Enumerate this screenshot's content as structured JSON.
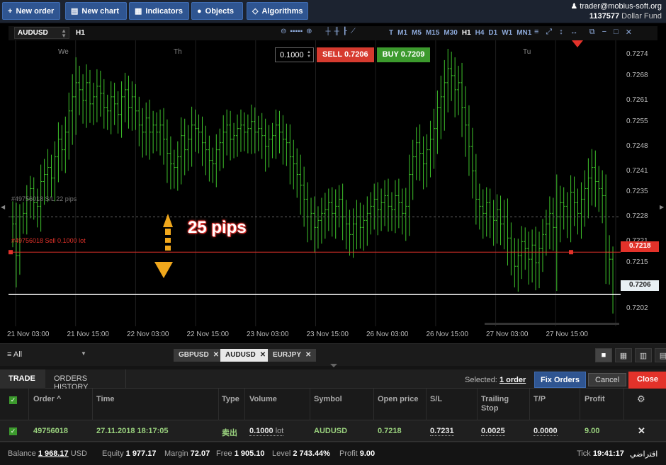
{
  "toolbar": {
    "new_order": "New order",
    "new_chart": "New chart",
    "indicators": "Indicators",
    "objects": "Objects",
    "algorithms": "Algorithms"
  },
  "account": {
    "user": "trader@mobius-soft.org",
    "id": "1137577",
    "name": "Dollar Fund"
  },
  "chart": {
    "symbol": "AUDUSD",
    "timeframe": "H1",
    "timeframes": [
      "T",
      "M1",
      "M5",
      "M15",
      "M30",
      "H1",
      "H4",
      "D1",
      "W1",
      "MN1"
    ],
    "active_timeframe": "H1",
    "lot_value": "0.1000",
    "sell_label": "SELL",
    "sell_price": "0.7206",
    "buy_label": "BUY",
    "buy_price": "0.7209",
    "day_labels": [
      "We",
      "Th",
      "Tu"
    ],
    "sl_label": "#49756018 S/L 22 pips",
    "order_label": "#49756018 Sell 0.1000 lot",
    "pips_annotation": "25 pips",
    "order_price_tag": "0.7218",
    "bid_price_tag": "0.7206"
  },
  "chart_data": {
    "type": "ohlc",
    "ylim": [
      0.7197,
      0.7278
    ],
    "y_ticks": [
      "0.7274",
      "0.7268",
      "0.7261",
      "0.7255",
      "0.7248",
      "0.7241",
      "0.7235",
      "0.7228",
      "0.7221",
      "0.7215",
      "0.7208",
      "0.7202"
    ],
    "x_ticks": [
      "21 Nov 03:00",
      "21 Nov 15:00",
      "22 Nov 03:00",
      "22 Nov 15:00",
      "23 Nov 03:00",
      "23 Nov 15:00",
      "26 Nov 03:00",
      "26 Nov 15:00",
      "27 Nov 03:00",
      "27 Nov 15:00"
    ],
    "close": [
      0.7226,
      0.7217,
      0.7228,
      0.7229,
      0.7233,
      0.7236,
      0.7232,
      0.7231,
      0.7238,
      0.724,
      0.7242,
      0.7239,
      0.7245,
      0.725,
      0.7247,
      0.7252,
      0.7258,
      0.7262,
      0.7266,
      0.7264,
      0.7261,
      0.7266,
      0.726,
      0.7262,
      0.7265,
      0.7263,
      0.7259,
      0.7258,
      0.7262,
      0.726,
      0.7257,
      0.7262,
      0.7264,
      0.7259,
      0.7262,
      0.7258,
      0.7254,
      0.7252,
      0.7256,
      0.7252,
      0.7254,
      0.7252,
      0.7254,
      0.725,
      0.7246,
      0.7243,
      0.7242,
      0.7245,
      0.7251,
      0.7247,
      0.725,
      0.7254,
      0.7253,
      0.7252,
      0.7249,
      0.7247,
      0.7244,
      0.7243,
      0.7247,
      0.7249,
      0.7252,
      0.7254,
      0.725,
      0.7251,
      0.7253,
      0.7254,
      0.7252,
      0.7253,
      0.7255,
      0.7252,
      0.7253,
      0.7251,
      0.7248,
      0.725,
      0.7251,
      0.7254,
      0.7252,
      0.725,
      0.7249,
      0.7245,
      0.7243,
      0.724,
      0.7237,
      0.7233,
      0.7228,
      0.7229,
      0.7225,
      0.7227,
      0.7229,
      0.723,
      0.7232,
      0.7229,
      0.7231,
      0.7233,
      0.7228,
      0.7226,
      0.7223,
      0.7226,
      0.7228,
      0.7225,
      0.7227,
      0.7229,
      0.7231,
      0.7233,
      0.723,
      0.7232,
      0.7234,
      0.7231,
      0.723,
      0.7234,
      0.7232,
      0.7229,
      0.7231,
      0.724,
      0.7245,
      0.7249,
      0.7246,
      0.7243,
      0.7247,
      0.725,
      0.7253,
      0.7259,
      0.7262,
      0.7266,
      0.727,
      0.7268,
      0.7264,
      0.7266,
      0.7259,
      0.7254,
      0.7248,
      0.7241,
      0.7233,
      0.7231,
      0.7229,
      0.7232,
      0.7228,
      0.7227,
      0.723,
      0.7226,
      0.7228,
      0.7222,
      0.7218,
      0.7214,
      0.7217,
      0.7221,
      0.7219,
      0.7216,
      0.722,
      0.7215,
      0.7219,
      0.7223,
      0.7226,
      0.7229,
      0.7225,
      0.7228,
      0.7232,
      0.7231,
      0.7228,
      0.7235,
      0.7232,
      0.7229,
      0.7233,
      0.7236,
      0.7239,
      0.7242,
      0.7238,
      0.7236,
      0.7234,
      0.7218,
      0.7216,
      0.7206
    ],
    "wick": [
      0.0011,
      0.0015,
      0.0009,
      0.0008,
      0.001,
      0.0009,
      0.0008,
      0.001,
      0.0012,
      0.0011,
      0.0013,
      0.0009,
      0.0011,
      0.0012,
      0.001,
      0.0011,
      0.0013,
      0.0016,
      0.0018,
      0.0012,
      0.0011,
      0.0013,
      0.0009,
      0.001,
      0.0012,
      0.0011,
      0.001,
      0.0009,
      0.0011,
      0.001,
      0.0009,
      0.0011,
      0.0012,
      0.001,
      0.0011,
      0.0009,
      0.001,
      0.0012,
      0.0011,
      0.0013,
      0.001,
      0.0009,
      0.0011,
      0.0012,
      0.0014,
      0.0012,
      0.001,
      0.0011,
      0.0013,
      0.0012,
      0.001,
      0.0013,
      0.0011,
      0.001,
      0.0011,
      0.0012,
      0.001,
      0.0009,
      0.0011,
      0.001,
      0.0012,
      0.0011,
      0.001,
      0.0009,
      0.001,
      0.0011,
      0.0009,
      0.001,
      0.0012,
      0.001,
      0.0009,
      0.0011,
      0.0012,
      0.001,
      0.0009,
      0.0011,
      0.001,
      0.0012,
      0.0011,
      0.0013,
      0.0012,
      0.0011,
      0.0014,
      0.0013,
      0.0012,
      0.0011,
      0.0012,
      0.001,
      0.0011,
      0.0012,
      0.001,
      0.0011,
      0.0012,
      0.001,
      0.0011,
      0.0012,
      0.001,
      0.0011,
      0.0012,
      0.001,
      0.0011,
      0.0012,
      0.001,
      0.0011,
      0.0012,
      0.001,
      0.0011,
      0.0012,
      0.001,
      0.0011,
      0.0012,
      0.001,
      0.0013,
      0.0014,
      0.0012,
      0.0011,
      0.0013,
      0.0012,
      0.0011,
      0.0013,
      0.0014,
      0.0012,
      0.0015,
      0.0016,
      0.0014,
      0.0012,
      0.0013,
      0.0012,
      0.0014,
      0.0015,
      0.0014,
      0.0013,
      0.0012,
      0.0011,
      0.0012,
      0.0011,
      0.001,
      0.0012,
      0.0011,
      0.001,
      0.0012,
      0.0013,
      0.0011,
      0.001,
      0.0012,
      0.0011,
      0.001,
      0.0012,
      0.0011,
      0.0013,
      0.0012,
      0.0011,
      0.001,
      0.0012,
      0.0011,
      0.003,
      0.0012,
      0.0011,
      0.001,
      0.0012,
      0.0011,
      0.001,
      0.0012,
      0.0013,
      0.0014,
      0.0013,
      0.0012,
      0.0011,
      0.0013,
      0.0015,
      0.0012,
      0.0009
    ],
    "h_lines": [
      {
        "name": "sl",
        "price": 0.7228,
        "style": "dashed",
        "color": "#666666"
      },
      {
        "name": "order",
        "price": 0.7218,
        "style": "solid",
        "color": "#e3322a"
      },
      {
        "name": "bid",
        "price": 0.7206,
        "style": "solid",
        "color": "#ffffff"
      }
    ],
    "candle_color": "#3ec22b"
  },
  "bottom_tabs": {
    "filter": "All",
    "symbols": [
      {
        "label": "GBPUSD",
        "active": false
      },
      {
        "label": "AUDUSD",
        "active": true
      },
      {
        "label": "EURJPY",
        "active": false
      }
    ]
  },
  "panel": {
    "tab_trade": "TRADE",
    "tab_history": "ORDERS HISTORY",
    "selected_prefix": "Selected:",
    "selected_count": "1 order",
    "fix_orders": "Fix Orders",
    "cancel": "Cancel",
    "close": "Close"
  },
  "grid": {
    "headers": {
      "order": "Order",
      "time": "Time",
      "type": "Type",
      "volume": "Volume",
      "symbol": "Symbol",
      "open_price": "Open price",
      "sl": "S/L",
      "trailing_1": "Trailing",
      "trailing_2": "Stop",
      "tp": "T/P",
      "profit": "Profit"
    },
    "row": {
      "order": "49756018",
      "time": "27.11.2018 18:17:05",
      "type": "卖出",
      "volume": "0.1000",
      "volume_unit": "lot",
      "symbol": "AUDUSD",
      "open_price": "0.7218",
      "sl": "0.7231",
      "trailing": "0.0025",
      "tp": "0.0000",
      "profit": "9.00"
    }
  },
  "status": {
    "balance_label": "Balance",
    "balance": "1 968.17",
    "currency": "USD",
    "equity_label": "Equity",
    "equity": "1 977.17",
    "margin_label": "Margin",
    "margin": "72.07",
    "free_label": "Free",
    "free": "1 905.10",
    "level_label": "Level",
    "level": "2 743.44%",
    "profit_label": "Profit",
    "profit": "9.00",
    "tick_label": "Tick",
    "tick_time": "19:41:17",
    "locale": "اقتراضي"
  }
}
